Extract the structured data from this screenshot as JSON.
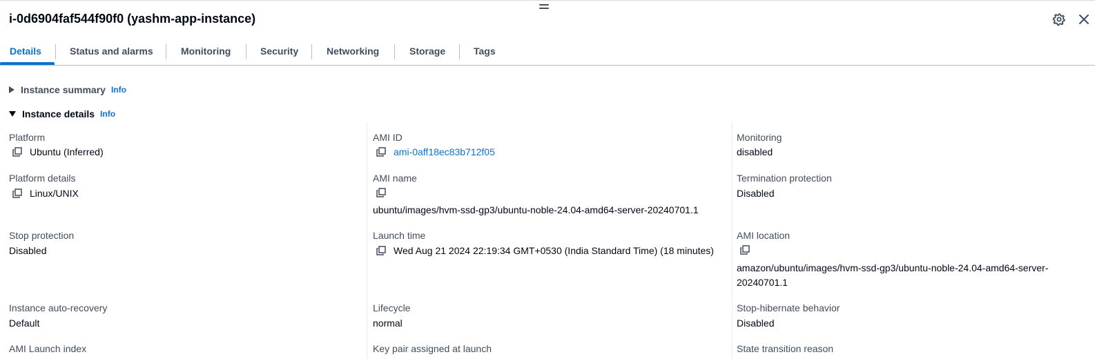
{
  "panel": {
    "title": "i-0d6904faf544f90f0 (yashm-app-instance)"
  },
  "tabs": [
    {
      "label": "Details",
      "active": true
    },
    {
      "label": "Status and alarms"
    },
    {
      "label": "Monitoring"
    },
    {
      "label": "Security"
    },
    {
      "label": "Networking"
    },
    {
      "label": "Storage"
    },
    {
      "label": "Tags"
    }
  ],
  "sections": {
    "summary": {
      "label": "Instance summary",
      "info": "Info",
      "expanded": false
    },
    "details": {
      "label": "Instance details",
      "info": "Info",
      "expanded": true
    }
  },
  "fields": {
    "platform": {
      "label": "Platform",
      "value": "Ubuntu (Inferred)"
    },
    "platform_details": {
      "label": "Platform details",
      "value": "Linux/UNIX"
    },
    "stop_protection": {
      "label": "Stop protection",
      "value": "Disabled"
    },
    "auto_recovery": {
      "label": "Instance auto-recovery",
      "value": "Default"
    },
    "ami_launch_index": {
      "label": "AMI Launch index"
    },
    "ami_id": {
      "label": "AMI ID",
      "value": "ami-0aff18ec83b712f05"
    },
    "ami_name": {
      "label": "AMI name",
      "value": "ubuntu/images/hvm-ssd-gp3/ubuntu-noble-24.04-amd64-server-20240701.1"
    },
    "launch_time": {
      "label": "Launch time",
      "value": "Wed Aug 21 2024 22:19:34 GMT+0530 (India Standard Time) (18 minutes)"
    },
    "lifecycle": {
      "label": "Lifecycle",
      "value": "normal"
    },
    "key_pair": {
      "label": "Key pair assigned at launch"
    },
    "monitoring": {
      "label": "Monitoring",
      "value": "disabled"
    },
    "termination_protection": {
      "label": "Termination protection",
      "value": "Disabled"
    },
    "ami_location": {
      "label": "AMI location",
      "value": "amazon/ubuntu/images/hvm-ssd-gp3/ubuntu-noble-24.04-amd64-server-20240701.1"
    },
    "stop_hibernate": {
      "label": "Stop-hibernate behavior",
      "value": "Disabled"
    },
    "state_transition": {
      "label": "State transition reason"
    }
  },
  "icons": {
    "settings": "gear-icon",
    "close": "close-icon",
    "copy": "copy-icon",
    "drag": "drag-handle-icon"
  },
  "colors": {
    "accent": "#0972d3",
    "text": "#000716",
    "muted": "#414d5c",
    "divider": "#b6bec9"
  }
}
